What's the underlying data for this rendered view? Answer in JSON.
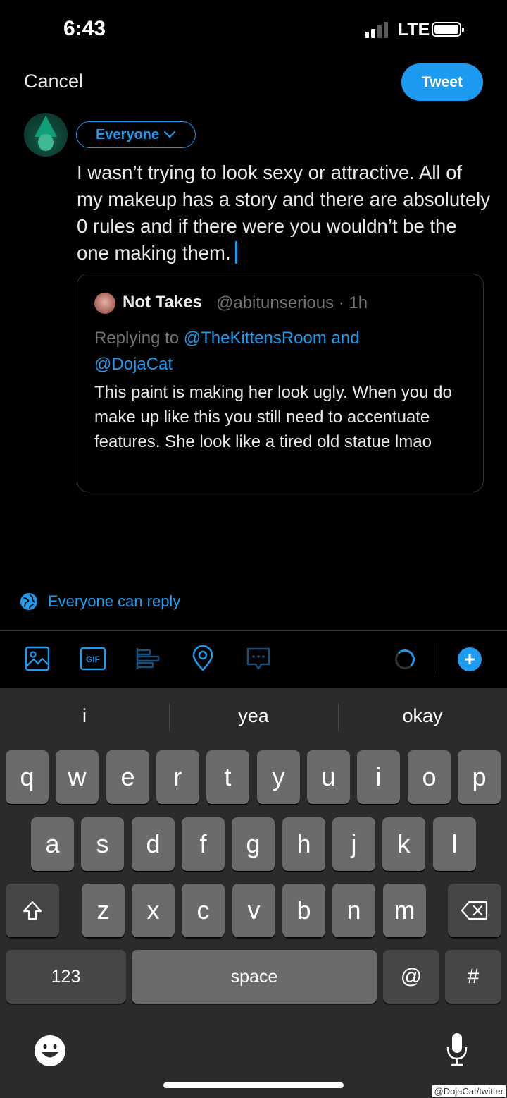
{
  "status_bar": {
    "time": "6:43",
    "network": "LTE"
  },
  "header": {
    "cancel_label": "Cancel",
    "tweet_label": "Tweet"
  },
  "composer": {
    "audience_label": "Everyone",
    "text": "I wasn’t trying to look sexy or attractive. All of my makeup has a story and there are absolutely 0 rules and if there were you wouldn’t be the one making them."
  },
  "quoted_tweet": {
    "author_name": "Not Takes",
    "handle_time": "@abitunserious · 1h",
    "replying_prefix": "Replying to ",
    "mention_1": "@TheKittensRoom",
    "and_word": " and",
    "mention_2": "@DojaCat",
    "body": "This paint is making her look ugly. When you do make up like this you still need to accentuate features. She look like a tired old statue lmao"
  },
  "reply_setting": {
    "label": "Everyone can reply"
  },
  "toolbar": {
    "icons": [
      "image-icon",
      "gif-icon",
      "poll-icon",
      "location-icon",
      "thread-icon"
    ],
    "gif_label": "GIF",
    "add_label": "+"
  },
  "keyboard": {
    "suggestions": [
      "i",
      "yea",
      "okay"
    ],
    "row1": [
      "q",
      "w",
      "e",
      "r",
      "t",
      "y",
      "u",
      "i",
      "o",
      "p"
    ],
    "row2": [
      "a",
      "s",
      "d",
      "f",
      "g",
      "h",
      "j",
      "k",
      "l"
    ],
    "row3": [
      "z",
      "x",
      "c",
      "v",
      "b",
      "n",
      "m"
    ],
    "numbers_label": "123",
    "space_label": "space",
    "at_label": "@",
    "hash_label": "#"
  },
  "watermark": "@DojaCat/twitter",
  "colors": {
    "accent": "#1d9bf0",
    "background": "#000000",
    "keyboard_bg": "#2b2b2d",
    "key": "#6b6b6e"
  }
}
